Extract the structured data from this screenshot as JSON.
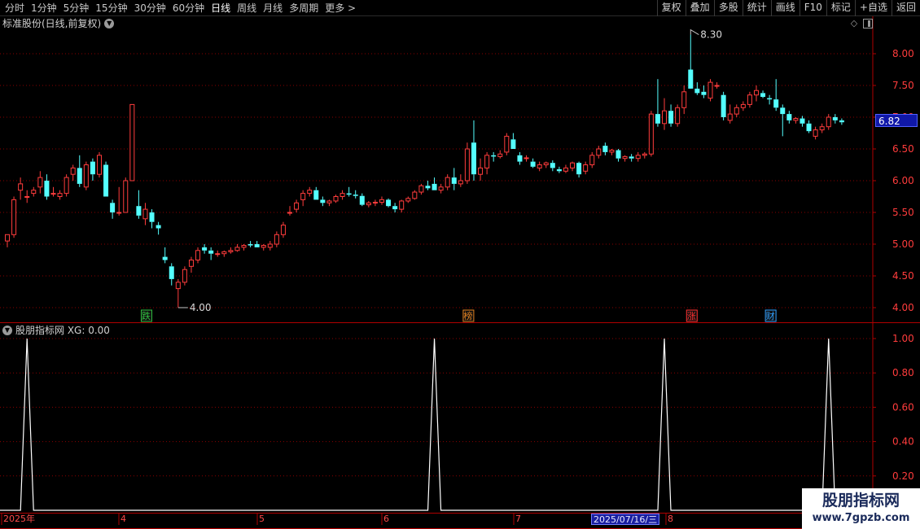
{
  "toolbar": {
    "periods": [
      "分时",
      "1分钟",
      "5分钟",
      "15分钟",
      "30分钟",
      "60分钟",
      "日线",
      "周线",
      "月线",
      "多周期",
      "更多 >"
    ],
    "active_period": "日线",
    "actions": [
      "复权",
      "叠加",
      "多股",
      "统计",
      "画线",
      "F10",
      "标记",
      "+自选",
      "返回"
    ]
  },
  "stock": {
    "title": "标准股份(日线,前复权)",
    "current_price": "6.82",
    "high_marker": "8.30",
    "low_marker": "4.00"
  },
  "indicator": {
    "title": "股朋指标网 XG: 0.00"
  },
  "event_tags": [
    {
      "label": "跌",
      "color": "#30c040"
    },
    {
      "label": "榜",
      "color": "#e08020"
    },
    {
      "label": "涨",
      "color": "#ff3030"
    },
    {
      "label": "财",
      "color": "#30a0ff"
    }
  ],
  "x_axis": {
    "ticks": [
      "2025年",
      "4",
      "5",
      "6",
      "7",
      "8"
    ],
    "cursor_date": "2025/07/16/三"
  },
  "watermark": {
    "name": "股朋指标网",
    "url": "www.7gpzb.com"
  },
  "colors": {
    "up": "#ff3c3c",
    "down": "#54ffff",
    "grid": "#8a0000",
    "axis": "#b00000",
    "signal": "#ffffff",
    "cursor": "#1018a8"
  },
  "chart_data": [
    {
      "type": "candlestick",
      "title": "标准股份(日线,前复权)",
      "ylim": [
        3.85,
        8.5
      ],
      "y_ticks": [
        "8.00",
        "7.50",
        "7.00",
        "6.50",
        "6.00",
        "5.50",
        "5.00",
        "4.50",
        "4.00"
      ],
      "ohlc": [
        [
          5.05,
          5.15,
          4.95,
          5.15
        ],
        [
          5.15,
          5.75,
          5.1,
          5.7
        ],
        [
          5.85,
          6.05,
          5.7,
          5.95
        ],
        [
          5.75,
          5.85,
          5.65,
          5.75
        ],
        [
          5.8,
          5.9,
          5.75,
          5.85
        ],
        [
          5.9,
          6.15,
          5.8,
          6.05
        ],
        [
          6.0,
          6.1,
          5.7,
          5.75
        ],
        [
          5.8,
          5.9,
          5.75,
          5.8
        ],
        [
          5.75,
          5.85,
          5.7,
          5.8
        ],
        [
          5.8,
          6.1,
          5.75,
          6.05
        ],
        [
          6.1,
          6.25,
          6.0,
          6.2
        ],
        [
          6.2,
          6.4,
          5.9,
          5.95
        ],
        [
          5.9,
          6.3,
          5.85,
          6.25
        ],
        [
          6.3,
          6.35,
          6.0,
          6.1
        ],
        [
          6.1,
          6.45,
          6.05,
          6.4
        ],
        [
          6.25,
          6.3,
          5.75,
          5.75
        ],
        [
          5.65,
          5.7,
          5.4,
          5.5
        ],
        [
          5.5,
          5.9,
          5.45,
          5.5
        ],
        [
          5.5,
          6.05,
          5.5,
          6.0
        ],
        [
          6.0,
          7.2,
          6.0,
          7.2
        ],
        [
          5.6,
          5.85,
          5.4,
          5.45
        ],
        [
          5.4,
          5.65,
          5.3,
          5.55
        ],
        [
          5.5,
          5.55,
          5.25,
          5.35
        ],
        [
          5.3,
          5.35,
          5.15,
          5.25
        ],
        [
          4.8,
          4.95,
          4.7,
          4.75
        ],
        [
          4.65,
          4.7,
          4.35,
          4.45
        ],
        [
          4.3,
          4.45,
          4.0,
          4.4
        ],
        [
          4.4,
          4.65,
          4.35,
          4.6
        ],
        [
          4.65,
          4.8,
          4.55,
          4.75
        ],
        [
          4.75,
          4.95,
          4.7,
          4.9
        ],
        [
          4.95,
          5.0,
          4.85,
          4.9
        ],
        [
          4.9,
          4.95,
          4.75,
          4.85
        ],
        [
          4.85,
          4.9,
          4.8,
          4.85
        ],
        [
          4.85,
          4.9,
          4.8,
          4.88
        ],
        [
          4.88,
          4.95,
          4.85,
          4.9
        ],
        [
          4.9,
          5.0,
          4.88,
          4.95
        ],
        [
          4.95,
          5.0,
          4.9,
          4.98
        ],
        [
          5.0,
          5.05,
          4.95,
          4.98
        ],
        [
          5.0,
          5.05,
          4.95,
          4.95
        ],
        [
          4.95,
          5.0,
          4.9,
          4.98
        ],
        [
          4.95,
          5.05,
          4.9,
          5.0
        ],
        [
          5.0,
          5.2,
          4.95,
          5.15
        ],
        [
          5.15,
          5.35,
          5.1,
          5.3
        ],
        [
          5.5,
          5.6,
          5.45,
          5.5
        ],
        [
          5.55,
          5.7,
          5.5,
          5.65
        ],
        [
          5.7,
          5.85,
          5.6,
          5.8
        ],
        [
          5.8,
          5.9,
          5.75,
          5.85
        ],
        [
          5.85,
          5.9,
          5.7,
          5.7
        ],
        [
          5.7,
          5.75,
          5.6,
          5.65
        ],
        [
          5.65,
          5.7,
          5.6,
          5.68
        ],
        [
          5.68,
          5.78,
          5.65,
          5.75
        ],
        [
          5.75,
          5.85,
          5.7,
          5.8
        ],
        [
          5.8,
          5.9,
          5.75,
          5.78
        ],
        [
          5.78,
          5.85,
          5.72,
          5.76
        ],
        [
          5.76,
          5.8,
          5.6,
          5.62
        ],
        [
          5.62,
          5.68,
          5.58,
          5.65
        ],
        [
          5.65,
          5.7,
          5.6,
          5.66
        ],
        [
          5.66,
          5.75,
          5.62,
          5.7
        ],
        [
          5.7,
          5.72,
          5.58,
          5.6
        ],
        [
          5.6,
          5.65,
          5.5,
          5.55
        ],
        [
          5.55,
          5.7,
          5.5,
          5.68
        ],
        [
          5.68,
          5.75,
          5.65,
          5.72
        ],
        [
          5.72,
          5.85,
          5.7,
          5.82
        ],
        [
          5.82,
          5.95,
          5.78,
          5.92
        ],
        [
          5.92,
          6.0,
          5.85,
          5.88
        ],
        [
          5.95,
          6.05,
          5.85,
          5.85
        ],
        [
          5.85,
          5.95,
          5.8,
          5.9
        ],
        [
          5.9,
          6.1,
          5.85,
          6.05
        ],
        [
          6.05,
          6.2,
          5.85,
          5.95
        ],
        [
          5.95,
          6.1,
          5.9,
          6.0
        ],
        [
          6.0,
          6.6,
          5.95,
          6.5
        ],
        [
          6.6,
          6.95,
          6.0,
          6.1
        ],
        [
          6.1,
          6.35,
          6.0,
          6.2
        ],
        [
          6.2,
          6.45,
          6.1,
          6.4
        ],
        [
          6.4,
          6.45,
          6.3,
          6.38
        ],
        [
          6.38,
          6.48,
          6.35,
          6.42
        ],
        [
          6.45,
          6.75,
          6.4,
          6.7
        ],
        [
          6.65,
          6.75,
          6.5,
          6.5
        ],
        [
          6.4,
          6.45,
          6.25,
          6.3
        ],
        [
          6.35,
          6.4,
          6.3,
          6.36
        ],
        [
          6.3,
          6.35,
          6.2,
          6.22
        ],
        [
          6.2,
          6.3,
          6.15,
          6.25
        ],
        [
          6.25,
          6.3,
          6.2,
          6.28
        ],
        [
          6.28,
          6.32,
          6.15,
          6.2
        ],
        [
          6.18,
          6.22,
          6.12,
          6.15
        ],
        [
          6.15,
          6.25,
          6.12,
          6.2
        ],
        [
          6.2,
          6.3,
          6.15,
          6.28
        ],
        [
          6.28,
          6.3,
          6.05,
          6.1
        ],
        [
          6.15,
          6.3,
          6.1,
          6.25
        ],
        [
          6.25,
          6.45,
          6.2,
          6.4
        ],
        [
          6.4,
          6.55,
          6.35,
          6.5
        ],
        [
          6.55,
          6.6,
          6.4,
          6.45
        ],
        [
          6.45,
          6.5,
          6.4,
          6.48
        ],
        [
          6.48,
          6.5,
          6.3,
          6.35
        ],
        [
          6.35,
          6.4,
          6.3,
          6.38
        ],
        [
          6.38,
          6.42,
          6.3,
          6.35
        ],
        [
          6.35,
          6.45,
          6.3,
          6.4
        ],
        [
          6.4,
          6.45,
          6.35,
          6.42
        ],
        [
          6.42,
          7.1,
          6.38,
          7.05
        ],
        [
          7.05,
          7.6,
          6.85,
          6.9
        ],
        [
          6.9,
          7.3,
          6.8,
          7.1
        ],
        [
          7.1,
          7.2,
          6.85,
          6.9
        ],
        [
          6.9,
          7.2,
          6.85,
          7.15
        ],
        [
          7.15,
          7.5,
          7.05,
          7.4
        ],
        [
          7.75,
          8.3,
          7.55,
          7.45
        ],
        [
          7.45,
          7.55,
          7.35,
          7.38
        ],
        [
          7.4,
          7.5,
          7.3,
          7.35
        ],
        [
          7.3,
          7.6,
          7.25,
          7.55
        ],
        [
          7.5,
          7.55,
          7.45,
          7.5
        ],
        [
          7.35,
          7.4,
          6.95,
          7.0
        ],
        [
          6.95,
          7.2,
          6.9,
          7.05
        ],
        [
          7.05,
          7.2,
          7.0,
          7.15
        ],
        [
          7.15,
          7.25,
          7.1,
          7.2
        ],
        [
          7.2,
          7.4,
          7.15,
          7.35
        ],
        [
          7.35,
          7.5,
          7.25,
          7.42
        ],
        [
          7.38,
          7.42,
          7.3,
          7.32
        ],
        [
          7.3,
          7.35,
          7.2,
          7.28
        ],
        [
          7.28,
          7.6,
          7.1,
          7.15
        ],
        [
          7.15,
          7.2,
          6.7,
          7.05
        ],
        [
          7.05,
          7.1,
          6.9,
          6.95
        ],
        [
          6.95,
          7.0,
          6.9,
          6.98
        ],
        [
          6.98,
          7.02,
          6.85,
          6.9
        ],
        [
          6.9,
          6.95,
          6.75,
          6.78
        ],
        [
          6.7,
          6.85,
          6.65,
          6.8
        ],
        [
          6.8,
          6.9,
          6.75,
          6.85
        ],
        [
          6.85,
          7.05,
          6.8,
          7.0
        ],
        [
          7.0,
          7.05,
          6.9,
          6.95
        ],
        [
          6.95,
          6.98,
          6.88,
          6.92
        ]
      ]
    },
    {
      "type": "line",
      "title": "股朋指标网 XG: 0.00",
      "series": [
        {
          "name": "XG",
          "values": [
            0,
            1,
            0,
            0,
            1,
            0,
            0,
            1,
            0,
            1,
            0,
            0
          ]
        }
      ],
      "spike_bar_index": [
        3,
        65,
        100,
        125
      ],
      "ylim": [
        0,
        1.05
      ],
      "y_ticks": [
        "1.00",
        "0.80",
        "0.60",
        "0.40",
        "0.20"
      ]
    }
  ]
}
